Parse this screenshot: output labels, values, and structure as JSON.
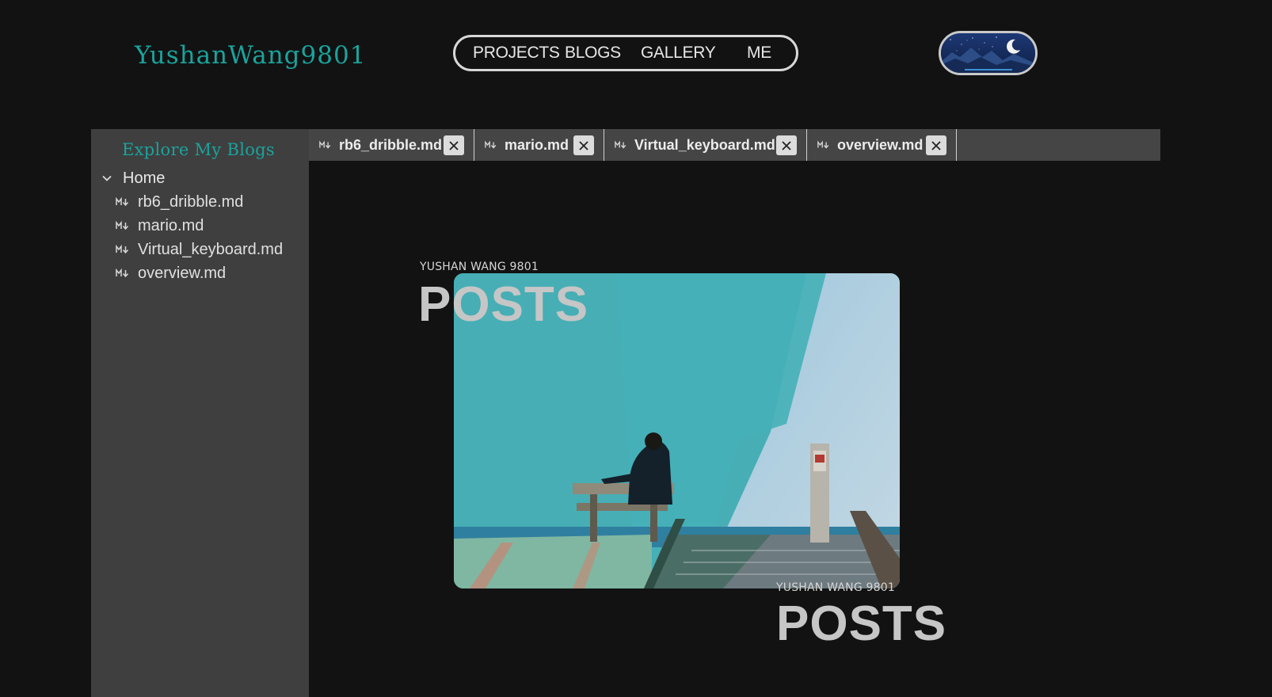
{
  "header": {
    "logo": "YushanWang9801",
    "nav": [
      "PROJECTS",
      "BLOGS",
      "GALLERY",
      "ME"
    ],
    "theme_toggle_icon": "moon-icon"
  },
  "sidebar": {
    "title": "Explore My Blogs",
    "root_label": "Home",
    "items": [
      "rb6_dribble.md",
      "mario.md",
      "Virtual_keyboard.md",
      "overview.md"
    ],
    "file_icon": "markdown-icon"
  },
  "tabs": [
    "rb6_dribble.md",
    "mario.md",
    "Virtual_keyboard.md",
    "overview.md"
  ],
  "hero": {
    "kicker": "YUSHAN WANG 9801",
    "heading": "POSTS",
    "kicker_bottom": "YUSHAN WANG 9801",
    "heading_bottom": "POSTS"
  },
  "colors": {
    "accent": "#1aa39d",
    "page_bg": "#121212",
    "sidebar_bg": "#3f3f3f",
    "tab_bar_bg": "#454545",
    "image_teal": "#47aeb5"
  }
}
